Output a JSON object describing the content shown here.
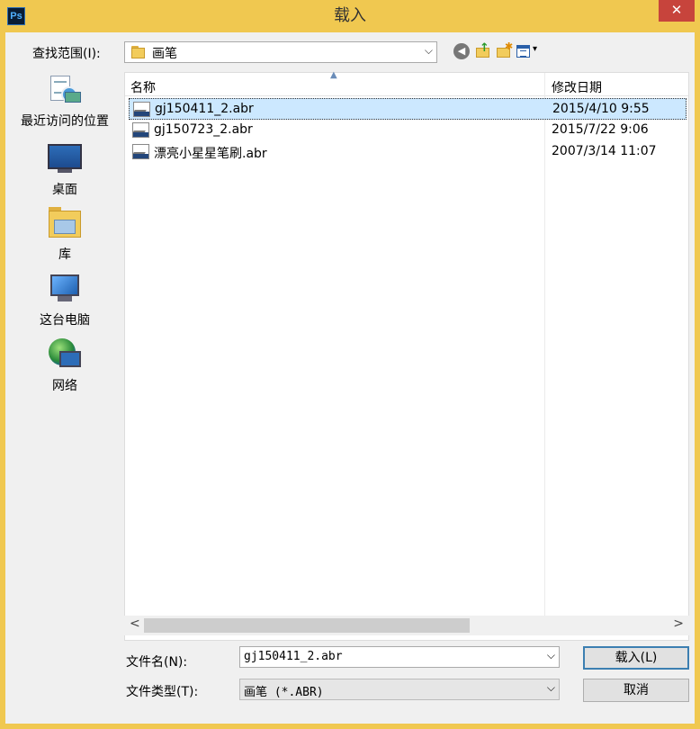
{
  "window": {
    "title": "载入",
    "app_icon_text": "Ps",
    "close_symbol": "✕"
  },
  "lookin": {
    "label": "查找范围(I):",
    "value": "画笔"
  },
  "toolbar": {
    "back_symbol": "◀",
    "up_symbol": "↑",
    "new_folder_symbol": "✱",
    "view_symbol": "▾"
  },
  "places": [
    {
      "label": "最近访问的位置",
      "icon": "recent-places-icon"
    },
    {
      "label": "桌面",
      "icon": "desktop-icon"
    },
    {
      "label": "库",
      "icon": "library-icon"
    },
    {
      "label": "这台电脑",
      "icon": "this-pc-icon"
    },
    {
      "label": "网络",
      "icon": "network-icon"
    }
  ],
  "filelist": {
    "columns": {
      "name": "名称",
      "date": "修改日期"
    },
    "files": [
      {
        "name": "gj150411_2.abr",
        "date": "2015/4/10 9:55",
        "selected": true
      },
      {
        "name": "gj150723_2.abr",
        "date": "2015/7/22 9:06",
        "selected": false
      },
      {
        "name": "漂亮小星星笔刷.abr",
        "date": "2007/3/14 11:07",
        "selected": false
      }
    ]
  },
  "footer": {
    "filename_label": "文件名(N):",
    "filename_value": "gj150411_2.abr",
    "filetype_label": "文件类型(T):",
    "filetype_value": "画笔 (*.ABR)",
    "load_button": "载入(L)",
    "cancel_button": "取消"
  },
  "colors": {
    "titlebar": "#f0c850",
    "close": "#c7443c",
    "selection": "#cce8ff"
  }
}
